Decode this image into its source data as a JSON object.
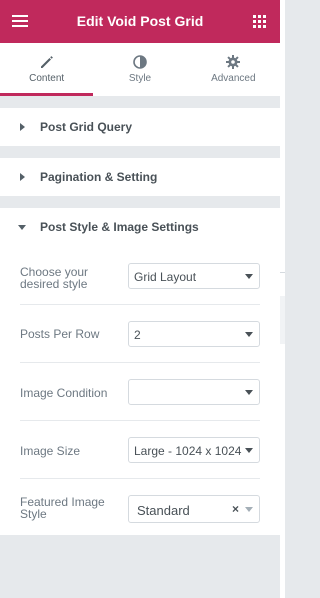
{
  "header": {
    "title": "Edit Void Post Grid",
    "menu_icon": "hamburger-icon",
    "widgets_icon": "grid-icon",
    "color": "#c0295c"
  },
  "tabs": [
    {
      "label": "Content",
      "icon": "pencil-icon",
      "active": true
    },
    {
      "label": "Style",
      "icon": "contrast-icon",
      "active": false
    },
    {
      "label": "Advanced",
      "icon": "gear-icon",
      "active": false
    }
  ],
  "sections": {
    "query": {
      "title": "Post Grid Query"
    },
    "pagination": {
      "title": "Pagination & Setting"
    },
    "style": {
      "title": "Post Style & Image Settings",
      "controls": {
        "style": {
          "label": "Choose your desired style",
          "value": "Grid Layout"
        },
        "per_row": {
          "label": "Posts Per Row",
          "value": "2"
        },
        "image_condition": {
          "label": "Image Condition",
          "value": ""
        },
        "image_size": {
          "label": "Image Size",
          "value": "Large - 1024 x 1024"
        },
        "featured_style": {
          "label": "Featured Image Style",
          "value": "Standard",
          "clear": "×"
        }
      }
    }
  }
}
